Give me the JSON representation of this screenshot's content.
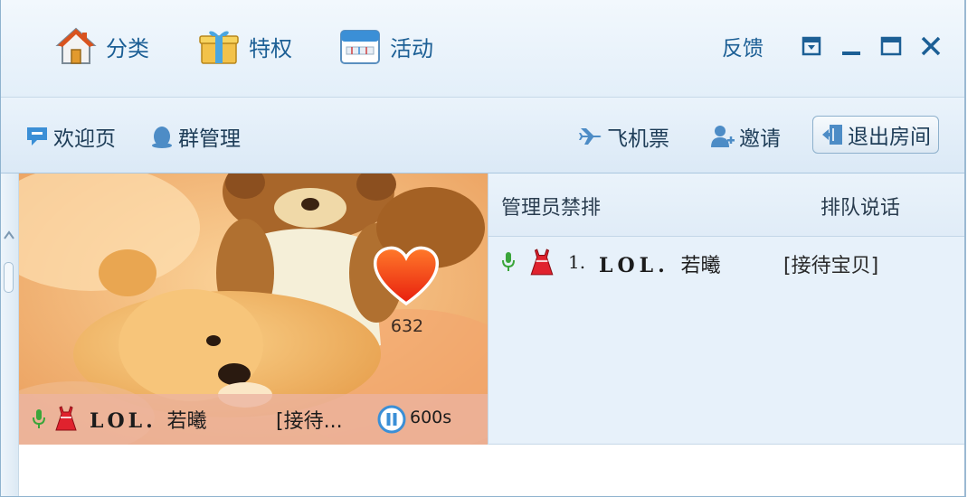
{
  "top_nav": {
    "items": [
      {
        "label": "分类",
        "icon": "house-icon"
      },
      {
        "label": "特权",
        "icon": "gift-icon"
      },
      {
        "label": "活动",
        "icon": "calendar-icon"
      }
    ],
    "feedback_label": "反馈"
  },
  "sub_nav": {
    "welcome_label": "欢迎页",
    "group_manage_label": "群管理",
    "flight_label": "飞机票",
    "invite_label": "邀请",
    "exit_label": "退出房间"
  },
  "video": {
    "like_count": "632",
    "performer": {
      "name_prefix": "LOL.",
      "name_cjk": "若曦",
      "role": "[接待...",
      "timer": "600s"
    }
  },
  "queue": {
    "header_left": "管理员禁排",
    "header_right": "排队说话",
    "entries": [
      {
        "index": "1.",
        "name_prefix": "LOL.",
        "name_cjk": "若曦",
        "role": "[接待宝贝]"
      }
    ]
  },
  "colors": {
    "accent": "#1c5f95",
    "mic_green": "#3aa53a",
    "badge_red": "#e0222e",
    "heart_red": "#f03a12"
  }
}
